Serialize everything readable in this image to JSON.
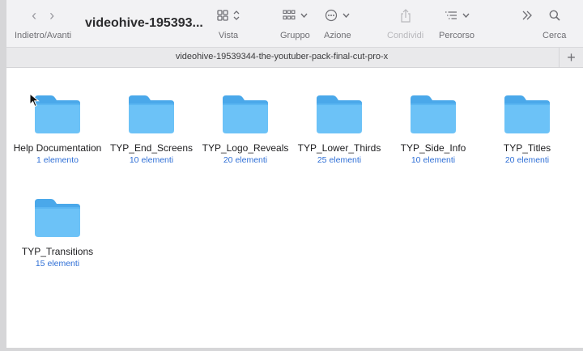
{
  "toolbar": {
    "nav_label": "Indietro/Avanti",
    "window_title": "videohive-195393...",
    "view_label": "Vista",
    "group_label": "Gruppo",
    "action_label": "Azione",
    "share_label": "Condividi",
    "path_label": "Percorso",
    "search_label": "Cerca"
  },
  "pathbar": {
    "title": "videohive-19539344-the-youtuber-pack-final-cut-pro-x",
    "add_tab": "+"
  },
  "folders": [
    {
      "name": "Help Documentation",
      "count": "1 elemento"
    },
    {
      "name": "TYP_End_Screens",
      "count": "10 elementi"
    },
    {
      "name": "TYP_Logo_Reveals",
      "count": "20 elementi"
    },
    {
      "name": "TYP_Lower_Thirds",
      "count": "25 elementi"
    },
    {
      "name": "TYP_Side_Info",
      "count": "10 elementi"
    },
    {
      "name": "TYP_Titles",
      "count": "20 elementi"
    },
    {
      "name": "TYP_Transitions",
      "count": "15 elementi"
    }
  ],
  "colors": {
    "folder_top": "#4aa8ea",
    "folder_body": "#6cc2f7",
    "count_text": "#2f6fd6"
  }
}
